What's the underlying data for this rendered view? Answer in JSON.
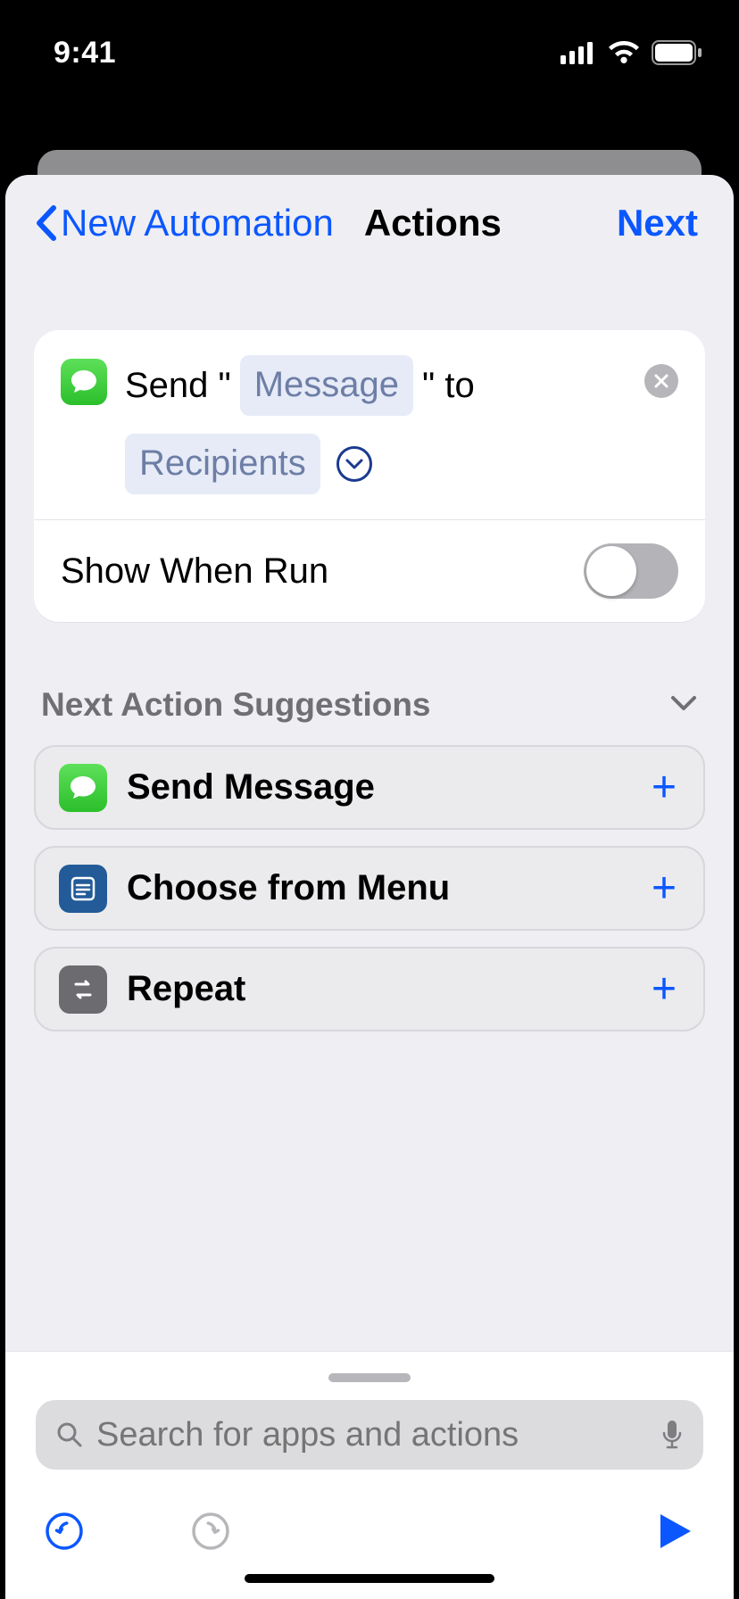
{
  "status": {
    "time": "9:41"
  },
  "nav": {
    "back": "New Automation",
    "title": "Actions",
    "next": "Next"
  },
  "action": {
    "send_prefix": "Send \"",
    "message_token": "Message",
    "send_mid": "\" to",
    "recipients_token": "Recipients",
    "show_when_run_label": "Show When Run",
    "show_when_run": false
  },
  "suggestions": {
    "header": "Next Action Suggestions",
    "items": [
      {
        "label": "Send Message"
      },
      {
        "label": "Choose from Menu"
      },
      {
        "label": "Repeat"
      }
    ]
  },
  "search": {
    "placeholder": "Search for apps and actions"
  }
}
